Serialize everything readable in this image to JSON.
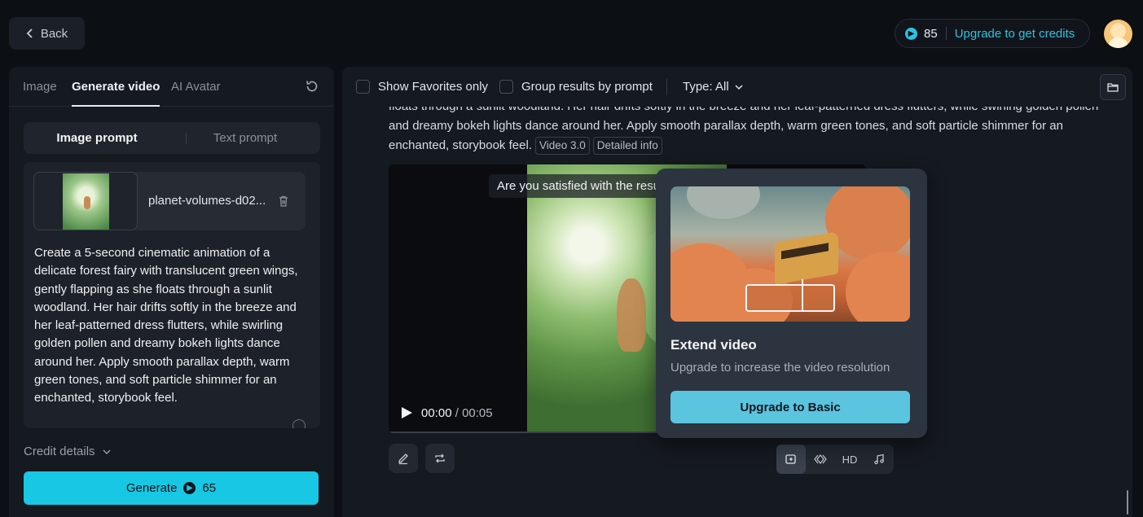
{
  "header": {
    "back_label": "Back",
    "credits": "85",
    "upgrade_label": "Upgrade to get credits"
  },
  "left": {
    "tabs": [
      {
        "label": "Image"
      },
      {
        "label": "Generate video"
      },
      {
        "label": "AI Avatar"
      }
    ],
    "segments": [
      {
        "label": "Image prompt"
      },
      {
        "label": "Text prompt"
      }
    ],
    "file_name": "planet-volumes-d02...",
    "prompt": "Create a 5-second cinematic animation of a delicate forest fairy with translucent green wings, gently flapping as she floats through a sunlit woodland. Her hair drifts softly in the breeze and her leaf-patterned dress flutters, while swirling golden pollen and dreamy bokeh lights dance around her. Apply smooth parallax depth, warm green tones, and soft particle shimmer for an enchanted, storybook feel.",
    "credit_details_label": "Credit details",
    "generate_label": "Generate",
    "generate_cost": "65"
  },
  "filters": {
    "favorites_label": "Show Favorites only",
    "group_label": "Group results by prompt",
    "type_label": "Type: All"
  },
  "result": {
    "text_line1": "floats through a sunlit woodland. Her hair drifts softly in the breeze and her leaf-patterned dress flutters, while swirling golden pollen",
    "text_line2": "and dreamy bokeh lights dance around her. Apply smooth parallax depth, warm green tones, and soft particle shimmer for an",
    "text_line3": "enchanted, storybook feel.",
    "model_tag": "Video 3.0",
    "detail_tag": "Detailed info",
    "banner": "Are you satisfied with the resu",
    "time_current": "00:00",
    "time_total": "00:05",
    "hd_label": "HD"
  },
  "popover": {
    "title": "Extend video",
    "subtitle": "Upgrade to increase the video resolution",
    "button": "Upgrade to Basic"
  }
}
